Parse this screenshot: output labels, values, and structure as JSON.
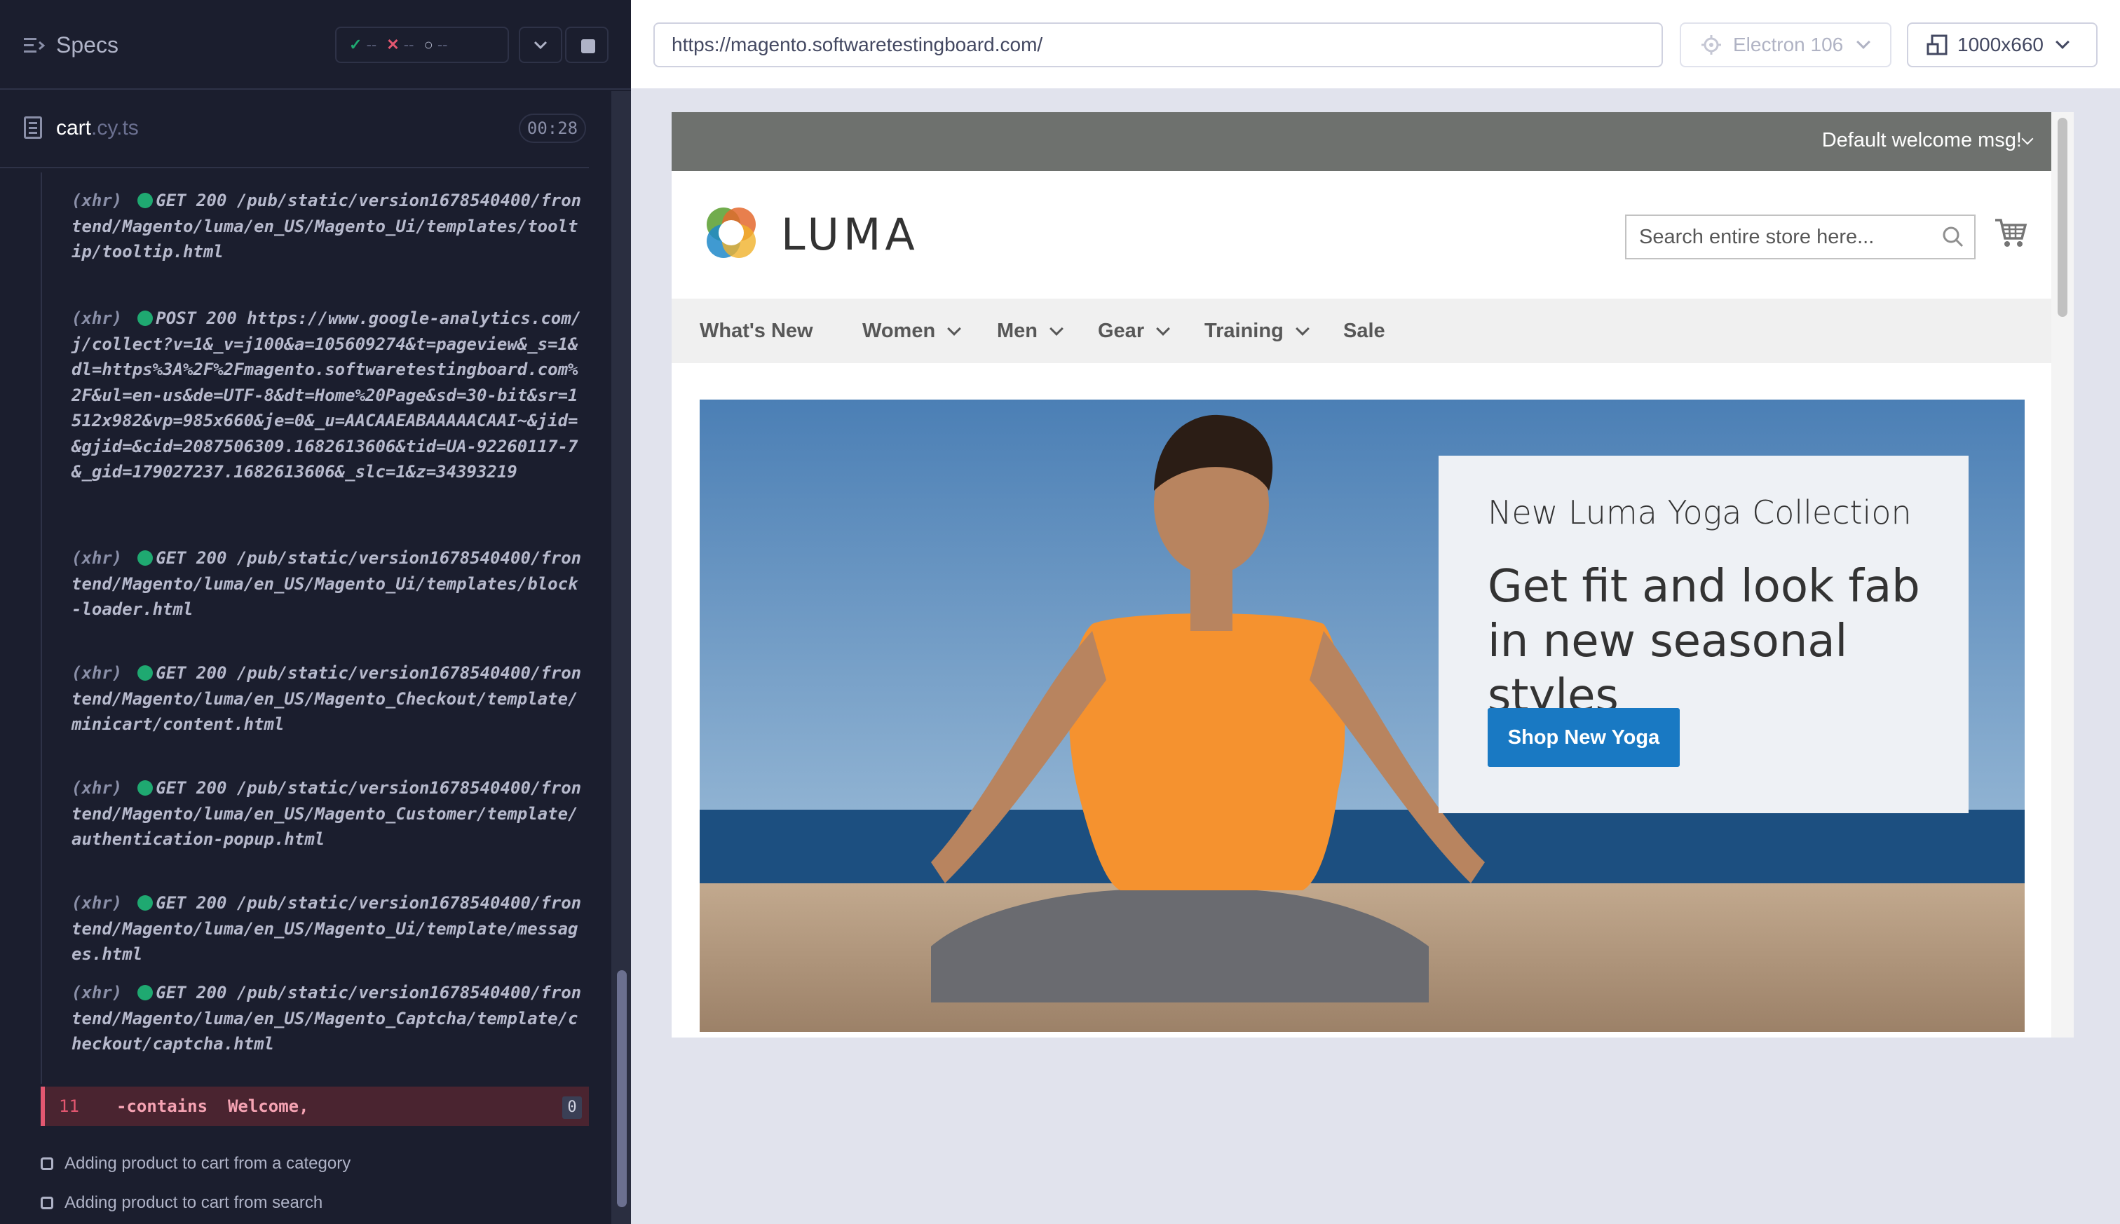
{
  "runner": {
    "specs_label": "Specs",
    "stats": {
      "passed": "--",
      "failed": "--",
      "pending": "--"
    },
    "file": {
      "name": "cart",
      "ext": ".cy.ts",
      "duration": "00:28"
    },
    "log_entries": [
      {
        "tag": "(xhr)",
        "method": "GET 200",
        "url": "/pub/static/version1678540400/frontend/Magento/luma/en_US/Magento_Ui/templates/tooltip/tooltip.html"
      },
      {
        "tag": "(xhr)",
        "method": "POST 200",
        "url": "https://www.google-analytics.com/j/collect?v=1&_v=j100&a=105609274&t=pageview&_s=1&dl=https%3A%2F%2Fmagento.softwaretestingboard.com%2F&ul=en-us&de=UTF-8&dt=Home%20Page&sd=30-bit&sr=1512x982&vp=985x660&je=0&_u=AACAAEABAAAAACAAI~&jid=&gjid=&cid=2087506309.1682613606&tid=UA-92260117-7&_gid=179027237.1682613606&_slc=1&z=34393219"
      },
      {
        "tag": "(xhr)",
        "method": "GET 200",
        "url": "/pub/static/version1678540400/frontend/Magento/luma/en_US/Magento_Ui/templates/block-loader.html"
      },
      {
        "tag": "(xhr)",
        "method": "GET 200",
        "url": "/pub/static/version1678540400/frontend/Magento/luma/en_US/Magento_Checkout/template/minicart/content.html"
      },
      {
        "tag": "(xhr)",
        "method": "GET 200",
        "url": "/pub/static/version1678540400/frontend/Magento/luma/en_US/Magento_Customer/template/authentication-popup.html"
      },
      {
        "tag": "(xhr)",
        "method": "GET 200",
        "url": "/pub/static/version1678540400/frontend/Magento/luma/en_US/Magento_Ui/template/messages.html"
      },
      {
        "tag": "(xhr)",
        "method": "GET 200",
        "url": "/pub/static/version1678540400/frontend/Magento/luma/en_US/Magento_Captcha/template/checkout/captcha.html"
      }
    ],
    "command": {
      "number": "11",
      "name": "-contains",
      "arg": "Welcome,",
      "count": "0"
    },
    "tests": [
      "Adding product to cart from a category",
      "Adding product to cart from search"
    ]
  },
  "browser_bar": {
    "url": "https://magento.softwaretestingboard.com/",
    "browser": "Electron 106",
    "viewport": "1000x660"
  },
  "site": {
    "welcome": "Default welcome msg!",
    "brand": "LUMA",
    "search_placeholder": "Search entire store here...",
    "nav": [
      "What's New",
      "Women",
      "Men",
      "Gear",
      "Training",
      "Sale"
    ],
    "hero": {
      "kicker": "New Luma Yoga Collection",
      "title": "Get fit and look fab in new seasonal styles",
      "button": "Shop New Yoga"
    }
  },
  "colors": {
    "runner_bg": "#1b1e2e",
    "pass": "#1fa971",
    "fail": "#e45770",
    "luma_blue": "#1979c3",
    "welcome_bar": "#6e716e"
  },
  "icons": [
    "specs-icon",
    "check-icon",
    "x-icon",
    "spinner-icon",
    "chevron-down-icon",
    "stop-icon",
    "file-icon",
    "gear-icon",
    "viewport-icon",
    "search-icon",
    "cart-icon"
  ]
}
